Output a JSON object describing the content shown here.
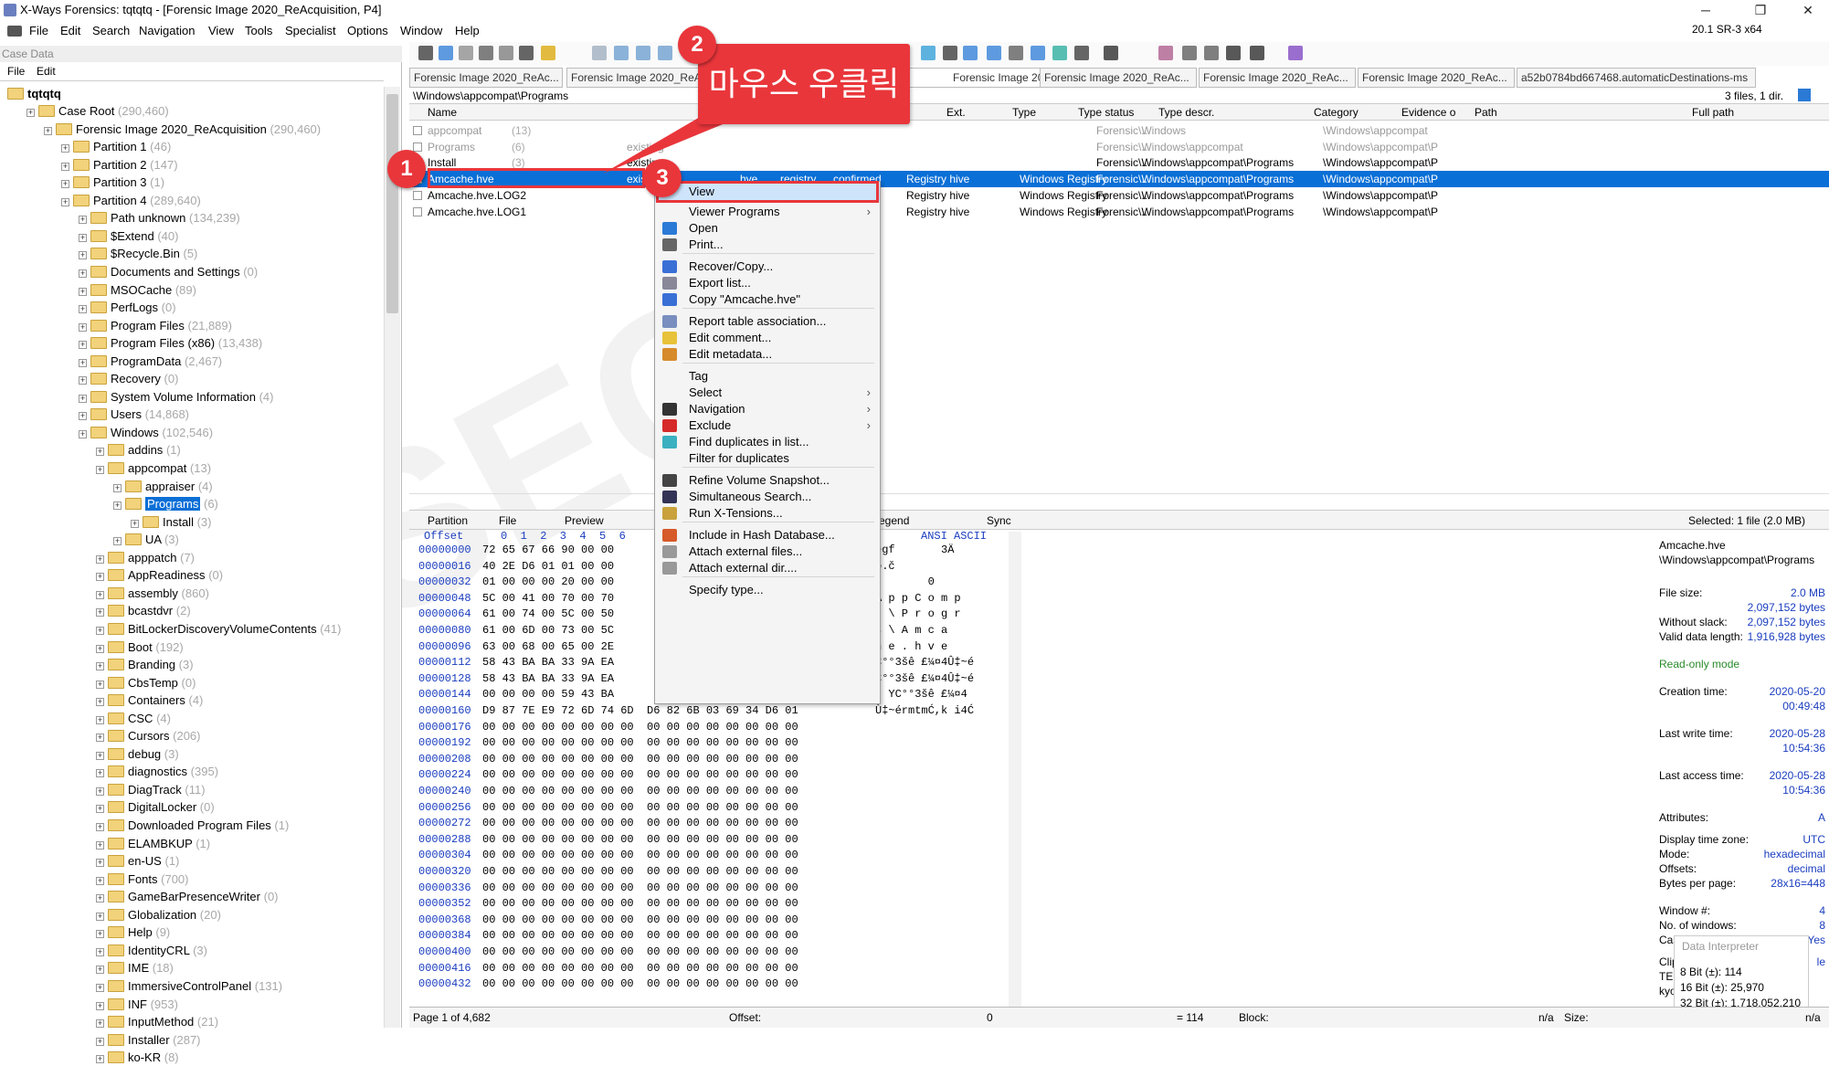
{
  "window": {
    "title": "X-Ways Forensics: tqtqtq - [Forensic Image 2020_ReAcquisition, P4]",
    "version": "20.1 SR-3 x64",
    "minimize": "─",
    "restore": "❐",
    "close": "✕"
  },
  "menu": [
    "File",
    "Edit",
    "Search",
    "Navigation",
    "View",
    "Tools",
    "Specialist",
    "Options",
    "Window",
    "Help"
  ],
  "case_panel": {
    "header": "Case Data",
    "menu": [
      "File",
      "Edit"
    ],
    "root": "tqtqtq",
    "items": [
      {
        "label": "Case Root",
        "count": "(290,460)"
      },
      {
        "label": "Forensic Image 2020_ReAcquisition",
        "count": "(290,460)"
      },
      {
        "label": "Partition 1",
        "count": "(46)"
      },
      {
        "label": "Partition 2",
        "count": "(147)"
      },
      {
        "label": "Partition 3",
        "count": "(1)"
      },
      {
        "label": "Partition 4",
        "count": "(289,640)"
      },
      {
        "label": "Path unknown",
        "count": "(134,239)"
      },
      {
        "label": "$Extend",
        "count": "(40)"
      },
      {
        "label": "$Recycle.Bin",
        "count": "(5)"
      },
      {
        "label": "Documents and Settings",
        "count": "(0)"
      },
      {
        "label": "MSOCache",
        "count": "(89)"
      },
      {
        "label": "PerfLogs",
        "count": "(0)"
      },
      {
        "label": "Program Files",
        "count": "(21,889)"
      },
      {
        "label": "Program Files (x86)",
        "count": "(13,438)"
      },
      {
        "label": "ProgramData",
        "count": "(2,467)"
      },
      {
        "label": "Recovery",
        "count": "(0)"
      },
      {
        "label": "System Volume Information",
        "count": "(4)"
      },
      {
        "label": "Users",
        "count": "(14,868)"
      },
      {
        "label": "Windows",
        "count": "(102,546)"
      },
      {
        "label": "addins",
        "count": "(1)"
      },
      {
        "label": "appcompat",
        "count": "(13)"
      },
      {
        "label": "appraiser",
        "count": "(4)"
      },
      {
        "label": "Programs",
        "count": "(6)"
      },
      {
        "label": "Install",
        "count": "(3)"
      },
      {
        "label": "UA",
        "count": "(3)"
      },
      {
        "label": "apppatch",
        "count": "(7)"
      },
      {
        "label": "AppReadiness",
        "count": "(0)"
      },
      {
        "label": "assembly",
        "count": "(860)"
      },
      {
        "label": "bcastdvr",
        "count": "(2)"
      },
      {
        "label": "BitLockerDiscoveryVolumeContents",
        "count": "(41)"
      },
      {
        "label": "Boot",
        "count": "(192)"
      },
      {
        "label": "Branding",
        "count": "(3)"
      },
      {
        "label": "CbsTemp",
        "count": "(0)"
      },
      {
        "label": "Containers",
        "count": "(4)"
      },
      {
        "label": "CSC",
        "count": "(4)"
      },
      {
        "label": "Cursors",
        "count": "(206)"
      },
      {
        "label": "debug",
        "count": "(3)"
      },
      {
        "label": "diagnostics",
        "count": "(395)"
      },
      {
        "label": "DiagTrack",
        "count": "(11)"
      },
      {
        "label": "DigitalLocker",
        "count": "(0)"
      },
      {
        "label": "Downloaded Program Files",
        "count": "(1)"
      },
      {
        "label": "ELAMBKUP",
        "count": "(1)"
      },
      {
        "label": "en-US",
        "count": "(1)"
      },
      {
        "label": "Fonts",
        "count": "(700)"
      },
      {
        "label": "GameBarPresenceWriter",
        "count": "(0)"
      },
      {
        "label": "Globalization",
        "count": "(20)"
      },
      {
        "label": "Help",
        "count": "(9)"
      },
      {
        "label": "IdentityCRL",
        "count": "(3)"
      },
      {
        "label": "IME",
        "count": "(18)"
      },
      {
        "label": "ImmersiveControlPanel",
        "count": "(131)"
      },
      {
        "label": "INF",
        "count": "(953)"
      },
      {
        "label": "InputMethod",
        "count": "(21)"
      },
      {
        "label": "Installer",
        "count": "(287)"
      },
      {
        "label": "ko-KR",
        "count": "(8)"
      }
    ]
  },
  "tabs": [
    "Forensic Image 2020_ReAc...",
    "Forensic Image 2020_ReAc...",
    "Forensic Image 2020_ReAc...",
    "Forensic Image 2020_ReAc...",
    "Forensic Image 2020_ReAc...",
    "Forensic Image 2020_ReAc...",
    "a52b0784bd667468.automaticDestinations-ms"
  ],
  "path": "\\Windows\\appcompat\\Programs",
  "path_count": "3 files, 1 dir.",
  "columns": [
    "Name",
    "Ext.",
    "Type",
    "Type status",
    "Type descr.",
    "Category",
    "Evidence o",
    "Path",
    "Full path"
  ],
  "files": [
    {
      "name": "appcompat",
      "size": "(13)",
      "status": "",
      "ext": "",
      "type": "",
      "tstatus": "",
      "descr": "",
      "cat": "",
      "ev": "Forensic ...",
      "path": "\\Windows",
      "full": "\\Windows\\appcompat"
    },
    {
      "name": "Programs",
      "size": "(6)",
      "status": "existing",
      "ext": "",
      "type": "",
      "tstatus": "",
      "descr": "",
      "cat": "",
      "ev": "Forensic ...",
      "path": "\\Windows\\appcompat",
      "full": "\\Windows\\appcompat\\P"
    },
    {
      "name": "Install",
      "size": "(3)",
      "status": "existing",
      "ext": "",
      "type": "",
      "tstatus": "",
      "descr": "",
      "cat": "",
      "ev": "Forensic ...",
      "path": "\\Windows\\appcompat\\Programs",
      "full": "\\Windows\\appcompat\\P"
    },
    {
      "name": "Amcache.hve",
      "size": "",
      "status": "existing",
      "ext": "hve",
      "type": "registry",
      "tstatus": "confirmed",
      "descr": "Registry hive",
      "cat": "Windows Registry",
      "ev": "Forensic ...",
      "path": "\\Windows\\appcompat\\Programs",
      "full": "\\Windows\\appcompat\\P"
    },
    {
      "name": "Amcache.hve.LOG2",
      "size": "",
      "status": "",
      "ext": "LOG2",
      "type": "registry",
      "tstatus": "confirmed",
      "descr": "Registry hive",
      "cat": "Windows Registry",
      "ev": "Forensic ...",
      "path": "\\Windows\\appcompat\\Programs",
      "full": "\\Windows\\appcompat\\P"
    },
    {
      "name": "Amcache.hve.LOG1",
      "size": "",
      "status": "",
      "ext": "LOG1",
      "type": "registry",
      "tstatus": "confirmed",
      "descr": "Registry hive",
      "cat": "Windows Registry",
      "ev": "Forensic ...",
      "path": "\\Windows\\appcompat\\Programs",
      "full": "\\Windows\\appcompat\\P"
    }
  ],
  "lower_tabs": {
    "partition": "Partition",
    "file": "File",
    "preview": "Preview",
    "legend": "egend",
    "sync": "Sync",
    "selected": "Selected: 1 file (2.0 MB)"
  },
  "hex": {
    "header_offset": "Offset",
    "header_cols": "0  1  2  3  4  5  6",
    "header_ascii": "ANSI ASCII",
    "rows": [
      {
        "off": "00000000",
        "bytes": "72 65 67 66 90 00 00",
        "ascii": "egf       3Ä"
      },
      {
        "off": "00000016",
        "bytes": "40 2E D6 01 01 00 00",
        "ascii": "p.č"
      },
      {
        "off": "00000032",
        "bytes": "01 00 00 00 20 00 00",
        "ascii": "        0"
      },
      {
        "off": "00000048",
        "bytes": "5C 00 41 00 70 00 70",
        "ascii": "A p p C o m p"
      },
      {
        "off": "00000064",
        "bytes": "61 00 74 00 5C 00 50",
        "ascii": "t \\ P r o g r"
      },
      {
        "off": "00000080",
        "bytes": "61 00 6D 00 73 00 5C",
        "ascii": "s \\ A m c a"
      },
      {
        "off": "00000096",
        "bytes": "63 00 68 00 65 00 2E",
        "ascii": "h e . h v e"
      },
      {
        "off": "00000112",
        "bytes": "58 43 BA BA 33 9A EA",
        "ascii": "C°°3šê £¼¤4Û‡~é"
      },
      {
        "off": "00000128",
        "bytes": "58 43 BA BA 33 9A EA",
        "ascii": "C°°3šê £¼¤4Û‡~é"
      },
      {
        "off": "00000144",
        "bytes": "00 00 00 00 59 43 BA",
        "ascii": "  YC°°3šê £¼¤4"
      },
      {
        "off": "00000160",
        "bytes": "D9 87 7E E9 72 6D 74 6D  D6 82 6B 03 69 34 D6 01",
        "ascii": "Ù‡~érmtmĆ,k i4Ć"
      },
      {
        "off": "00000176",
        "bytes": "00 00 00 00 00 00 00 00  00 00 00 00 00 00 00 00",
        "ascii": ""
      },
      {
        "off": "00000192",
        "bytes": "00 00 00 00 00 00 00 00  00 00 00 00 00 00 00 00",
        "ascii": ""
      },
      {
        "off": "00000208",
        "bytes": "00 00 00 00 00 00 00 00  00 00 00 00 00 00 00 00",
        "ascii": ""
      },
      {
        "off": "00000224",
        "bytes": "00 00 00 00 00 00 00 00  00 00 00 00 00 00 00 00",
        "ascii": ""
      },
      {
        "off": "00000240",
        "bytes": "00 00 00 00 00 00 00 00  00 00 00 00 00 00 00 00",
        "ascii": ""
      },
      {
        "off": "00000256",
        "bytes": "00 00 00 00 00 00 00 00  00 00 00 00 00 00 00 00",
        "ascii": ""
      },
      {
        "off": "00000272",
        "bytes": "00 00 00 00 00 00 00 00  00 00 00 00 00 00 00 00",
        "ascii": ""
      },
      {
        "off": "00000288",
        "bytes": "00 00 00 00 00 00 00 00  00 00 00 00 00 00 00 00",
        "ascii": ""
      },
      {
        "off": "00000304",
        "bytes": "00 00 00 00 00 00 00 00  00 00 00 00 00 00 00 00",
        "ascii": ""
      },
      {
        "off": "00000320",
        "bytes": "00 00 00 00 00 00 00 00  00 00 00 00 00 00 00 00",
        "ascii": ""
      },
      {
        "off": "00000336",
        "bytes": "00 00 00 00 00 00 00 00  00 00 00 00 00 00 00 00",
        "ascii": ""
      },
      {
        "off": "00000352",
        "bytes": "00 00 00 00 00 00 00 00  00 00 00 00 00 00 00 00",
        "ascii": ""
      },
      {
        "off": "00000368",
        "bytes": "00 00 00 00 00 00 00 00  00 00 00 00 00 00 00 00",
        "ascii": ""
      },
      {
        "off": "00000384",
        "bytes": "00 00 00 00 00 00 00 00  00 00 00 00 00 00 00 00",
        "ascii": ""
      },
      {
        "off": "00000400",
        "bytes": "00 00 00 00 00 00 00 00  00 00 00 00 00 00 00 00",
        "ascii": ""
      },
      {
        "off": "00000416",
        "bytes": "00 00 00 00 00 00 00 00  00 00 00 00 00 00 00 00",
        "ascii": ""
      },
      {
        "off": "00000432",
        "bytes": "00 00 00 00 00 00 00 00  00 00 00 00 00 00 00 00",
        "ascii": ""
      }
    ]
  },
  "info": {
    "name": "Amcache.hve",
    "path": "\\Windows\\appcompat\\Programs",
    "fields": [
      {
        "k": "File size:",
        "v": "2.0 MB"
      },
      {
        "k": "",
        "v": "2,097,152 bytes"
      },
      {
        "k": "Without slack:",
        "v": "2,097,152 bytes"
      },
      {
        "k": "Valid data length:",
        "v": "1,916,928 bytes"
      },
      {
        "k": "Read-only mode",
        "v": ""
      },
      {
        "k": "Creation time:",
        "v": "2020-05-20"
      },
      {
        "k": "",
        "v": "00:49:48"
      },
      {
        "k": "Last write time:",
        "v": "2020-05-28"
      },
      {
        "k": "",
        "v": "10:54:36"
      },
      {
        "k": "Last access time:",
        "v": "2020-05-28"
      },
      {
        "k": "",
        "v": "10:54:36"
      },
      {
        "k": "Attributes:",
        "v": "A"
      },
      {
        "k": "Display time zone:",
        "v": "UTC"
      },
      {
        "k": "Mode:",
        "v": "hexadecimal"
      },
      {
        "k": "Offsets:",
        "v": "decimal"
      },
      {
        "k": "Bytes per page:",
        "v": "28x16=448"
      },
      {
        "k": "Window #:",
        "v": "4"
      },
      {
        "k": "No. of windows:",
        "v": "8"
      },
      {
        "k": "Case",
        "v": "Yes"
      },
      {
        "k": "Clip",
        "v": "le"
      },
      {
        "k": "TEM",
        "v": ""
      },
      {
        "k": "kyo\\",
        "v": ""
      }
    ]
  },
  "data_interpreter": {
    "title": "Data Interpreter",
    "lines": [
      "8 Bit (±): 114",
      "16 Bit (±): 25,970",
      "32 Bit (±): 1,718,052,210"
    ]
  },
  "status": {
    "page": "Page 1 of 4,682",
    "offset_label": "Offset:",
    "offset_val": "0",
    "eq": "= 114",
    "block": "Block:",
    "na1": "n/a",
    "size": "Size:",
    "na2": "n/a"
  },
  "context_menu": {
    "items": [
      {
        "label": "View",
        "icon": "",
        "arrow": ""
      },
      {
        "label": "Viewer Programs",
        "icon": "",
        "arrow": "›"
      },
      {
        "label": "Open",
        "icon": "open-icon",
        "arrow": ""
      },
      {
        "label": "Print...",
        "icon": "print-icon",
        "arrow": ""
      },
      {
        "label": "Recover/Copy...",
        "icon": "copy-icon",
        "arrow": ""
      },
      {
        "label": "Export list...",
        "icon": "list-icon",
        "arrow": ""
      },
      {
        "label": "Copy \"Amcache.hve\"",
        "icon": "copy-icon",
        "arrow": ""
      },
      {
        "label": "Report table association...",
        "icon": "report-icon",
        "arrow": ""
      },
      {
        "label": "Edit comment...",
        "icon": "comment-icon",
        "arrow": ""
      },
      {
        "label": "Edit metadata...",
        "icon": "pencil-icon",
        "arrow": ""
      },
      {
        "label": "Tag",
        "icon": "",
        "arrow": ""
      },
      {
        "label": "Select",
        "icon": "",
        "arrow": "›"
      },
      {
        "label": "Navigation",
        "icon": "compass-icon",
        "arrow": "›"
      },
      {
        "label": "Exclude",
        "icon": "x-icon",
        "arrow": "›"
      },
      {
        "label": "Find duplicates in list...",
        "icon": "duplicate-icon",
        "arrow": ""
      },
      {
        "label": "Filter for duplicates",
        "icon": "",
        "arrow": ""
      },
      {
        "label": "Refine Volume Snapshot...",
        "icon": "refine-icon",
        "arrow": ""
      },
      {
        "label": "Simultaneous Search...",
        "icon": "binoculars-icon",
        "arrow": ""
      },
      {
        "label": "Run X-Tensions...",
        "icon": "xtension-icon",
        "arrow": ""
      },
      {
        "label": "Include in Hash Database...",
        "icon": "hash-icon",
        "arrow": ""
      },
      {
        "label": "Attach external files...",
        "icon": "attach-icon",
        "arrow": ""
      },
      {
        "label": "Attach external dir....",
        "icon": "attach-icon",
        "arrow": ""
      },
      {
        "label": "Specify type...",
        "icon": "",
        "arrow": ""
      }
    ]
  },
  "annotations": {
    "callout": "마우스 우클릭",
    "badge1": "1",
    "badge2": "2",
    "badge3": "3"
  },
  "colors": {
    "accent": "#e9363b",
    "selection": "#0a6fd6",
    "link": "#1a3dbf"
  }
}
